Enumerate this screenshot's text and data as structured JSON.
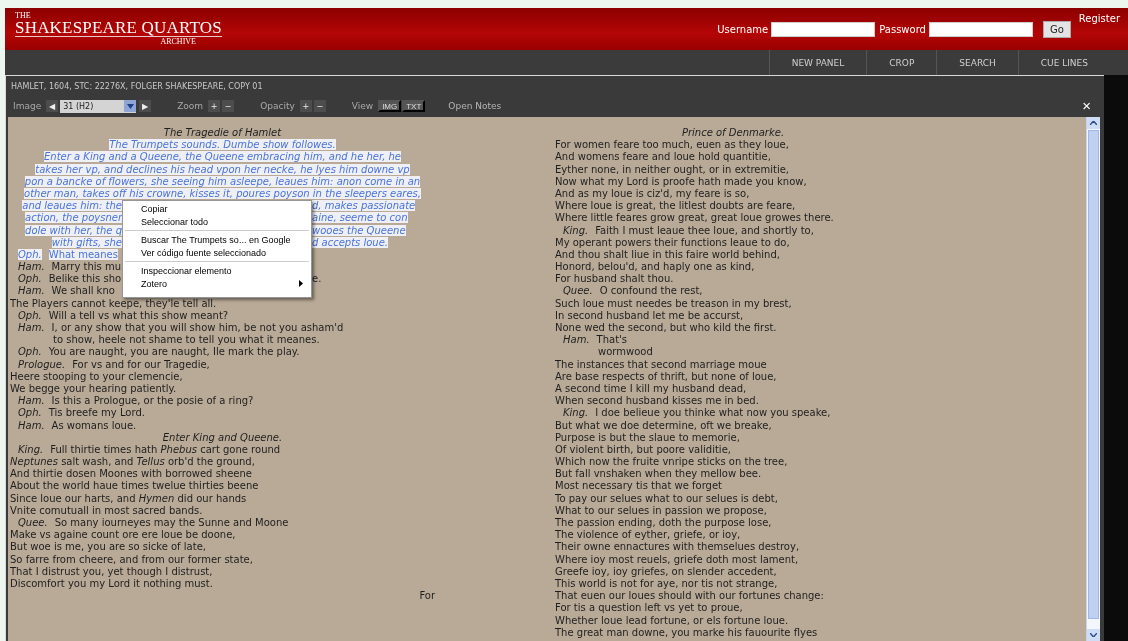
{
  "header": {
    "logo": {
      "top": "THE",
      "title": "SHAKESPEARE QUARTOS",
      "bottom": "ARCHIVE"
    },
    "login": {
      "username_label": "Username",
      "password_label": "Password",
      "go": "Go",
      "register": "Register"
    }
  },
  "nav": [
    "NEW PANEL",
    "CROP",
    "SEARCH",
    "CUE LINES"
  ],
  "panel": {
    "title": "HAMLET, 1604, STC: 22276X, FOLGER SHAKESPEARE, COPY 01",
    "toolbar": {
      "image_label": "Image",
      "prev": "◀",
      "page": "31 (H2)",
      "next": "▶",
      "zoom_label": "Zoom",
      "zoom_in": "+",
      "zoom_out": "−",
      "opacity_label": "Opacity",
      "opacity_up": "+",
      "opacity_down": "−",
      "view_label": "View",
      "views": [
        "IMG",
        "TXT"
      ],
      "notes": "Open Notes",
      "close": "×"
    },
    "pages": [
      {
        "lines": [
          {
            "kind": "stage",
            "text": "The Tragedie of Hamlet",
            "selected": false,
            "covered": false
          },
          {
            "kind": "stage",
            "text": "The Trumpets sounds. Dumbe show followes.",
            "selected": true,
            "covered": false
          },
          {
            "kind": "stage",
            "text": "Enter a King and a Queene, the Queene embracing him, and he her, he",
            "selected": true,
            "covered": false
          },
          {
            "kind": "stage",
            "text": "takes her vp, and declines his head vpon her necke, he lyes him downe vp",
            "selected": true,
            "covered": false
          },
          {
            "kind": "stage",
            "text": "pon a bancke of flowers, she seeing him asleepe, leaues him: anon come in an",
            "selected": true,
            "covered": false
          },
          {
            "kind": "stage",
            "text": "other man, takes off his crowne, kisses it, poures poyson in the sleepers eares,",
            "selected": true,
            "covered": false
          },
          {
            "kind": "stage",
            "text": "and leaues him: the",
            "after": "d, makes passionate",
            "selected": true,
            "covered": true
          },
          {
            "kind": "stage",
            "text": "action, the poysner",
            "after": "aine, seeme to con",
            "selected": true,
            "covered": true
          },
          {
            "kind": "stage",
            "text": "dole with her, the q",
            "after": "wooes the Queene",
            "selected": true,
            "covered": true
          },
          {
            "kind": "stage",
            "text": "with gifts, she",
            "after": "d accepts loue.",
            "selected": true,
            "covered": true
          },
          {
            "kind": "speech",
            "speaker": "Oph.",
            "text": "What meanes",
            "selected": true,
            "covered": true
          },
          {
            "kind": "speech",
            "speaker": "Ham.",
            "text": "Marry this mu",
            "selected": false,
            "covered": true
          },
          {
            "kind": "speech",
            "speaker": "Oph.",
            "text": "Belike this sho",
            "after": "e.",
            "selected": false,
            "covered": true
          },
          {
            "kind": "speech",
            "speaker": "Ham.",
            "text": "We shall kno",
            "selected": false,
            "covered": true
          },
          {
            "kind": "verse",
            "text": "The Players cannot keepe, they'le tell all.",
            "selected": false,
            "covered": false
          },
          {
            "kind": "speech",
            "speaker": "Oph.",
            "text": "Will a tell vs what this show meant?",
            "selected": false,
            "covered": false
          },
          {
            "kind": "speech",
            "speaker": "Ham.",
            "text": "I, or any show that you will show him, be not you asham'd",
            "selected": false,
            "covered": false
          },
          {
            "kind": "cont",
            "text": "to show, heele not shame to tell you what it meanes.",
            "selected": false,
            "covered": false
          },
          {
            "kind": "speech",
            "speaker": "Oph.",
            "text": "You are naught, you are naught, Ile mark the play.",
            "selected": false,
            "covered": false
          },
          {
            "kind": "speech",
            "speaker": "Prologue.",
            "text": "For vs and for our Tragedie,",
            "selected": false,
            "covered": false
          },
          {
            "kind": "verse",
            "text": "Heere stooping to your clemencie,",
            "selected": false,
            "covered": false
          },
          {
            "kind": "verse",
            "text": "We begge your hearing patiently.",
            "selected": false,
            "covered": false
          },
          {
            "kind": "speech",
            "speaker": "Ham.",
            "text": "Is this a Prologue, or the posie of a ring?",
            "selected": false,
            "covered": false
          },
          {
            "kind": "speech",
            "speaker": "Oph.",
            "text": "Tis breefe my Lord.",
            "selected": false,
            "covered": false
          },
          {
            "kind": "speech",
            "speaker": "Ham.",
            "text": "As womans loue.",
            "selected": false,
            "covered": false
          },
          {
            "kind": "stage",
            "text": "Enter King and Queene.",
            "selected": false,
            "covered": false
          },
          {
            "kind": "speech",
            "speaker": "King.",
            "text": "Full thirtie times hath *Phebus* cart gone round",
            "selected": false,
            "covered": false
          },
          {
            "kind": "verse",
            "text": "*Neptunes* salt wash, and *Tellus* orb'd the ground,",
            "selected": false,
            "covered": false
          },
          {
            "kind": "verse",
            "text": "And thirtie dosen Moones with borrowed sheene",
            "selected": false,
            "covered": false
          },
          {
            "kind": "verse",
            "text": "About the world haue times twelue thirties beene",
            "selected": false,
            "covered": false
          },
          {
            "kind": "verse",
            "text": "Since loue our harts, and *Hymen* did our hands",
            "selected": false,
            "covered": false
          },
          {
            "kind": "verse",
            "text": "Vnite comutuall in most sacred bands.",
            "selected": false,
            "covered": false
          },
          {
            "kind": "speech",
            "speaker": "Quee.",
            "text": "So many iourneyes may the Sunne and Moone",
            "selected": false,
            "covered": false
          },
          {
            "kind": "verse",
            "text": "Make vs againe count ore ere loue be doone,",
            "selected": false,
            "covered": false
          },
          {
            "kind": "verse",
            "text": "But woe is me, you are so sicke of late,",
            "selected": false,
            "covered": false
          },
          {
            "kind": "verse",
            "text": "So farre from cheere, and from our former state,",
            "selected": false,
            "covered": false
          },
          {
            "kind": "verse",
            "text": "That I distrust you, yet though I distrust,",
            "selected": false,
            "covered": false
          },
          {
            "kind": "verse",
            "text": "Discomfort you my Lord it nothing must.",
            "selected": false,
            "covered": false
          },
          {
            "kind": "catchword",
            "text": "For",
            "selected": false,
            "covered": false
          }
        ]
      },
      {
        "lines": [
          {
            "kind": "stage",
            "text": "Prince of Denmarke."
          },
          {
            "kind": "verse",
            "text": "For women feare too much, euen as they loue,"
          },
          {
            "kind": "verse",
            "text": "And womens feare and loue hold quantitie,"
          },
          {
            "kind": "verse",
            "text": "Eyther none, in neither ought, or in extremitie,"
          },
          {
            "kind": "verse",
            "text": "Now what my Lord is proofe hath made you know,"
          },
          {
            "kind": "verse",
            "text": "And as my loue is ciz'd, my feare is so,"
          },
          {
            "kind": "verse",
            "text": "Where loue is great, the litlest doubts are feare,"
          },
          {
            "kind": "verse",
            "text": "Where little feares grow great, great loue growes there."
          },
          {
            "kind": "speech",
            "speaker": "King.",
            "text": "Faith I must leaue thee loue, and shortly to,"
          },
          {
            "kind": "verse",
            "text": "My operant powers their functions leaue to do,"
          },
          {
            "kind": "verse",
            "text": "And thou shalt liue in this faire world behind,"
          },
          {
            "kind": "verse",
            "text": "Honord, belou'd, and haply one as kind,"
          },
          {
            "kind": "verse",
            "text": "For husband shalt thou."
          },
          {
            "kind": "speech",
            "speaker": "Quee.",
            "text": "O confound the rest,"
          },
          {
            "kind": "verse",
            "text": "Such loue must needes be treason in my brest,"
          },
          {
            "kind": "verse",
            "text": "In second husband let me be accurst,"
          },
          {
            "kind": "verse",
            "text": "None wed the second, but who kild the first."
          },
          {
            "kind": "speech",
            "speaker": "Ham.",
            "text": "That's"
          },
          {
            "kind": "cont",
            "text": "wormwood"
          },
          {
            "kind": "verse",
            "text": "The instances that second marriage moue"
          },
          {
            "kind": "verse",
            "text": "Are base respects of thrift, but none of loue,"
          },
          {
            "kind": "verse",
            "text": "A second time I kill my husband dead,"
          },
          {
            "kind": "verse",
            "text": "When second husband kisses me in bed."
          },
          {
            "kind": "speech",
            "speaker": "King.",
            "text": "I doe belieue you thinke what now you speake,"
          },
          {
            "kind": "verse",
            "text": "But what we doe determine, oft we breake,"
          },
          {
            "kind": "verse",
            "text": "Purpose is but the slaue to memorie,"
          },
          {
            "kind": "verse",
            "text": "Of violent birth, but poore validitie,"
          },
          {
            "kind": "verse",
            "text": "Which now the fruite vnripe sticks on the tree,"
          },
          {
            "kind": "verse",
            "text": "But fall vnshaken when they mellow bee."
          },
          {
            "kind": "verse",
            "text": "Most necessary tis that we forget"
          },
          {
            "kind": "verse",
            "text": "To pay our selues what to our selues is debt,"
          },
          {
            "kind": "verse",
            "text": "What to our selues in passion we propose,"
          },
          {
            "kind": "verse",
            "text": "The passion ending, doth the purpose lose,"
          },
          {
            "kind": "verse",
            "text": "The violence of eyther, griefe, or ioy,"
          },
          {
            "kind": "verse",
            "text": "Their owne ennactures with themselues destroy,"
          },
          {
            "kind": "verse",
            "text": "Where ioy most reuels, griefe doth most lament,"
          },
          {
            "kind": "verse",
            "text": "Greefe ioy, ioy griefes, on slender accedent,"
          },
          {
            "kind": "verse",
            "text": "This world is not for aye, nor tis not strange,"
          },
          {
            "kind": "verse",
            "text": "That euen our loues should with our fortunes change:"
          },
          {
            "kind": "verse",
            "text": "For tis a question left vs yet to proue,"
          },
          {
            "kind": "verse",
            "text": "Whether loue lead fortune, or els fortune loue."
          },
          {
            "kind": "verse",
            "text": "The great man downe, you marke his fauourite flyes"
          }
        ]
      }
    ]
  },
  "context_menu": {
    "items": [
      {
        "kind": "item",
        "label": "Copiar"
      },
      {
        "kind": "item",
        "label": "Seleccionar todo"
      },
      {
        "kind": "separator"
      },
      {
        "kind": "item",
        "label": "Buscar The Trumpets so... en Google"
      },
      {
        "kind": "item",
        "label": "Ver código fuente seleccionado"
      },
      {
        "kind": "separator"
      },
      {
        "kind": "item",
        "label": "Inspeccionar elemento"
      },
      {
        "kind": "submenu",
        "label": "Zotero"
      }
    ]
  }
}
